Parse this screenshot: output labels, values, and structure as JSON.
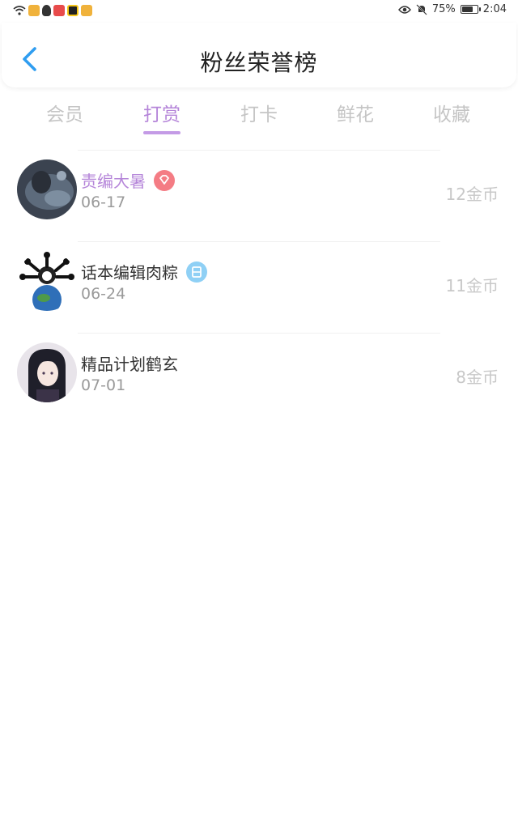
{
  "status_bar": {
    "battery_percent": "75%",
    "battery_level": 0.75,
    "time": "2:04"
  },
  "header": {
    "title": "粉丝荣誉榜"
  },
  "tabs": [
    {
      "label": "会员"
    },
    {
      "label": "打赏"
    },
    {
      "label": "打卡"
    },
    {
      "label": "鲜花"
    },
    {
      "label": "收藏"
    }
  ],
  "active_tab": "打赏",
  "fans": [
    {
      "name": "责编大暑",
      "date": "06-17",
      "coins": "12金币",
      "badge": "diamond-badge-icon"
    },
    {
      "name": "话本编辑肉粽",
      "date": "06-24",
      "coins": "11金币",
      "badge": "official-badge-icon"
    },
    {
      "name": "精品计划鹤玄",
      "date": "07-01",
      "coins": "8金币",
      "badge": ""
    }
  ],
  "colors": {
    "accent": "#b585d9",
    "diamond_badge": "#f47c84",
    "official_badge": "#8fd0f5",
    "back_arrow": "#2f9df0"
  }
}
